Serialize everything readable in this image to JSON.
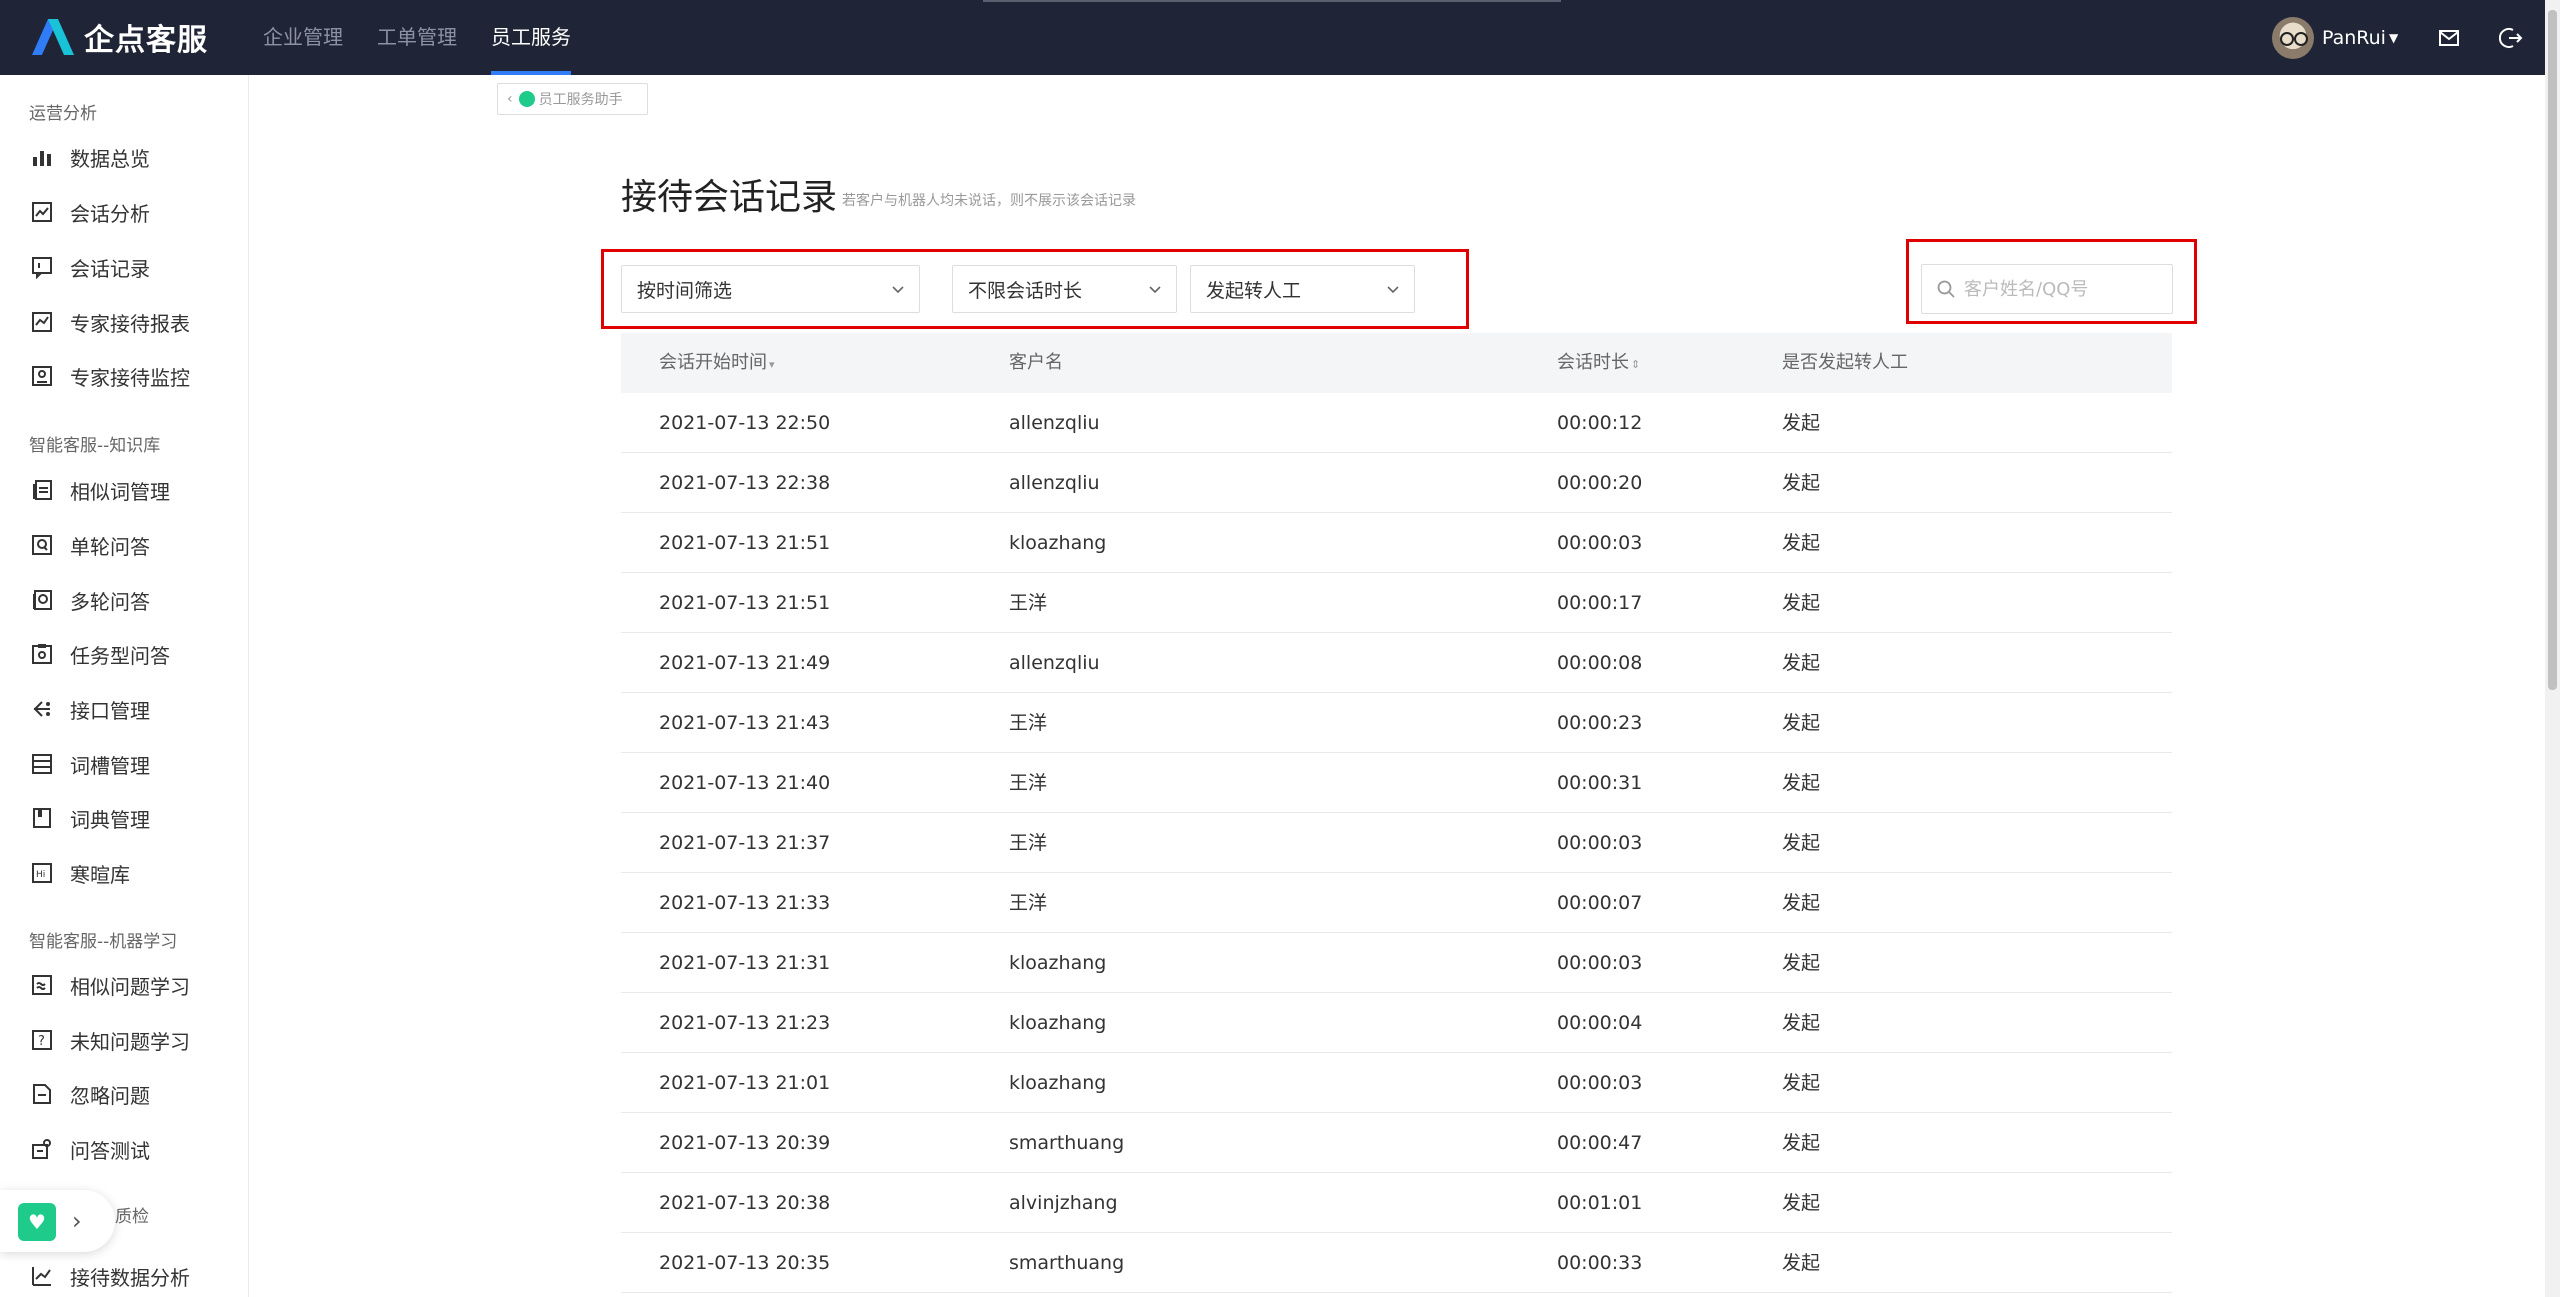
{
  "app": {
    "logo_text": "企点客服",
    "nav": [
      {
        "label": "企业管理",
        "active": false
      },
      {
        "label": "工单管理",
        "active": false
      },
      {
        "label": "员工服务",
        "active": true
      }
    ],
    "username": "PanRui",
    "accent_color": "#2f7cf6",
    "topbar_color": "#1f2436"
  },
  "sidebar": {
    "sections": [
      {
        "title": "运营分析",
        "items": [
          {
            "label": "数据总览",
            "icon": "bar-chart-icon"
          },
          {
            "label": "会话分析",
            "icon": "line-chart-icon"
          },
          {
            "label": "会话记录",
            "icon": "chat-record-icon"
          },
          {
            "label": "专家接待报表",
            "icon": "report-icon"
          },
          {
            "label": "专家接待监控",
            "icon": "monitor-icon"
          }
        ]
      },
      {
        "title": "智能客服--知识库",
        "items": [
          {
            "label": "相似词管理",
            "icon": "similar-words-icon"
          },
          {
            "label": "单轮问答",
            "icon": "single-qa-icon"
          },
          {
            "label": "多轮问答",
            "icon": "multi-qa-icon"
          },
          {
            "label": "任务型问答",
            "icon": "task-qa-icon"
          },
          {
            "label": "接口管理",
            "icon": "api-icon"
          },
          {
            "label": "词槽管理",
            "icon": "slot-icon"
          },
          {
            "label": "词典管理",
            "icon": "dictionary-icon"
          },
          {
            "label": "寒暄库",
            "icon": "greeting-icon"
          }
        ]
      },
      {
        "title": "智能客服--机器学习",
        "items": [
          {
            "label": "相似问题学习",
            "icon": "similar-question-icon"
          },
          {
            "label": "未知问题学习",
            "icon": "unknown-question-icon"
          },
          {
            "label": "忽略问题",
            "icon": "ignore-icon"
          },
          {
            "label": "问答测试",
            "icon": "qa-test-icon"
          }
        ]
      },
      {
        "title": "质检",
        "items": [
          {
            "label": "接待数据分析",
            "icon": "analysis-icon"
          }
        ]
      }
    ]
  },
  "main": {
    "back_button": "员工服务助手",
    "title": "接待会话记录",
    "subtitle": "若客户与机器人均未说话，则不展示该会话记录",
    "filters": {
      "time": "按时间筛选",
      "duration": "不限会话时长",
      "transfer": "发起转人工"
    },
    "search_placeholder": "客户姓名/QQ号",
    "table": {
      "headers": [
        "会话开始时间",
        "客户名",
        "会话时长",
        "是否发起转人工"
      ],
      "rows": [
        [
          "2021-07-13 22:50",
          "allenzqliu",
          "00:00:12",
          "发起"
        ],
        [
          "2021-07-13 22:38",
          "allenzqliu",
          "00:00:20",
          "发起"
        ],
        [
          "2021-07-13 21:51",
          "kloazhang",
          "00:00:03",
          "发起"
        ],
        [
          "2021-07-13 21:51",
          "王洋",
          "00:00:17",
          "发起"
        ],
        [
          "2021-07-13 21:49",
          "allenzqliu",
          "00:00:08",
          "发起"
        ],
        [
          "2021-07-13 21:43",
          "王洋",
          "00:00:23",
          "发起"
        ],
        [
          "2021-07-13 21:40",
          "王洋",
          "00:00:31",
          "发起"
        ],
        [
          "2021-07-13 21:37",
          "王洋",
          "00:00:03",
          "发起"
        ],
        [
          "2021-07-13 21:33",
          "王洋",
          "00:00:07",
          "发起"
        ],
        [
          "2021-07-13 21:31",
          "kloazhang",
          "00:00:03",
          "发起"
        ],
        [
          "2021-07-13 21:23",
          "kloazhang",
          "00:00:04",
          "发起"
        ],
        [
          "2021-07-13 21:01",
          "kloazhang",
          "00:00:03",
          "发起"
        ],
        [
          "2021-07-13 20:39",
          "smarthuang",
          "00:00:47",
          "发起"
        ],
        [
          "2021-07-13 20:38",
          "alvinjzhang",
          "00:01:01",
          "发起"
        ],
        [
          "2021-07-13 20:35",
          "smarthuang",
          "00:00:33",
          "发起"
        ]
      ]
    }
  }
}
